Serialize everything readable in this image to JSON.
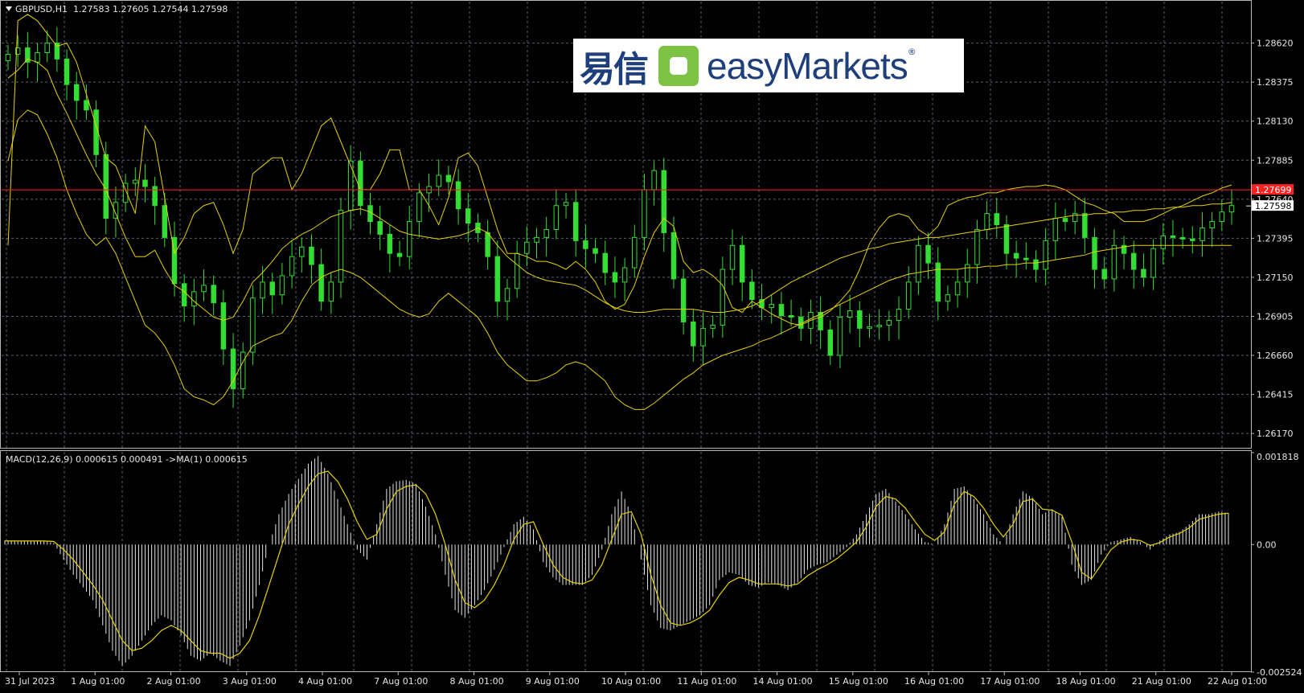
{
  "header": {
    "symbol": "GBPUSD,H1",
    "ohlc": "1.27583 1.27605 1.27544 1.27598"
  },
  "macd_header": "MACD(12,26,9) 0.000615 0.000491  ->MA(1) 0.000615",
  "logo": {
    "cn": "易信",
    "en": "easyMarkets",
    "reg": "®"
  },
  "colors": {
    "background": "#000000",
    "candle": "#33dd33",
    "bollinger": "#e6d200",
    "macd_hist": "#e6e6e6",
    "signal": "#e6d200",
    "ref_line": "#ff2020",
    "grid": "#566074",
    "axis_text": "#e6e6e6"
  },
  "price_labels": {
    "ref": "1.27699",
    "current": "1.27598"
  },
  "chart_data": [
    {
      "type": "line",
      "name": "price",
      "y_ticks": [
        "1.28620",
        "1.28375",
        "1.28130",
        "1.27885",
        "1.27640",
        "1.27395",
        "1.27150",
        "1.26905",
        "1.26660",
        "1.26415",
        "1.26170"
      ],
      "ylim": [
        1.2608,
        1.2885
      ],
      "x_tick_labels": [
        "31 Jul 2023",
        "1 Aug 01:00",
        "2 Aug 01:00",
        "3 Aug 01:00",
        "4 Aug 01:00",
        "7 Aug 01:00",
        "8 Aug 01:00",
        "9 Aug 01:00",
        "10 Aug 01:00",
        "11 Aug 01:00",
        "14 Aug 01:00",
        "15 Aug 01:00",
        "16 Aug 01:00",
        "17 Aug 01:00",
        "18 Aug 01:00",
        "21 Aug 01:00",
        "22 Aug 01:00"
      ],
      "close": [
        1.2855,
        1.2859,
        1.285,
        1.2856,
        1.2862,
        1.2852,
        1.2836,
        1.2826,
        1.282,
        1.2792,
        1.2752,
        1.2762,
        1.2774,
        1.2776,
        1.2772,
        1.276,
        1.274,
        1.2711,
        1.2697,
        1.2706,
        1.271,
        1.2699,
        1.267,
        1.2645,
        1.2668,
        1.2702,
        1.2712,
        1.2704,
        1.2716,
        1.2728,
        1.2734,
        1.2723,
        1.27,
        1.2712,
        1.2757,
        1.2788,
        1.276,
        1.275,
        1.2742,
        1.273,
        1.2728,
        1.275,
        1.2768,
        1.2772,
        1.2779,
        1.2775,
        1.2758,
        1.2749,
        1.2743,
        1.2728,
        1.27,
        1.2708,
        1.273,
        1.2737,
        1.274,
        1.2745,
        1.276,
        1.2762,
        1.2738,
        1.2733,
        1.273,
        1.2718,
        1.2712,
        1.2721,
        1.274,
        1.277,
        1.2782,
        1.2743,
        1.2714,
        1.2687,
        1.2672,
        1.2683,
        1.2685,
        1.272,
        1.2735,
        1.2712,
        1.2701,
        1.2696,
        1.2698,
        1.2691,
        1.269,
        1.2683,
        1.2693,
        1.2682,
        1.2666,
        1.269,
        1.2694,
        1.2683,
        1.2684,
        1.2685,
        1.2688,
        1.2695,
        1.2712,
        1.2735,
        1.2724,
        1.27,
        1.2704,
        1.2712,
        1.2723,
        1.2745,
        1.2755,
        1.2748,
        1.273,
        1.2727,
        1.2726,
        1.272,
        1.2738,
        1.2752,
        1.275,
        1.2755,
        1.274,
        1.272,
        1.2714,
        1.2735,
        1.273,
        1.272,
        1.2715,
        1.2733,
        1.2741,
        1.274,
        1.2739,
        1.2738,
        1.2746,
        1.275,
        1.2756,
        1.276
      ],
      "bollinger_upper": [
        1.2735,
        1.2876,
        1.288,
        1.2876,
        1.2868,
        1.286,
        1.2862,
        1.285,
        1.283,
        1.281,
        1.279,
        1.2785,
        1.277,
        1.2755,
        1.281,
        1.28,
        1.2765,
        1.273,
        1.274,
        1.2755,
        1.276,
        1.2762,
        1.2748,
        1.273,
        1.2745,
        1.278,
        1.2785,
        1.279,
        1.279,
        1.277,
        1.278,
        1.2795,
        1.281,
        1.2815,
        1.28,
        1.2785,
        1.277,
        1.277,
        1.278,
        1.2795,
        1.2795,
        1.277,
        1.277,
        1.276,
        1.2748,
        1.2765,
        1.279,
        1.2793,
        1.2785,
        1.2765,
        1.2745,
        1.273,
        1.273,
        1.2728,
        1.2725,
        1.2725,
        1.2723,
        1.272,
        1.2725,
        1.272,
        1.2712,
        1.27,
        1.2695,
        1.2698,
        1.271,
        1.2728,
        1.2743,
        1.2752,
        1.2747,
        1.2725,
        1.2718,
        1.272,
        1.2716,
        1.271,
        1.2696,
        1.2693,
        1.27,
        1.2696,
        1.2692,
        1.2689,
        1.2686,
        1.2685,
        1.2688,
        1.269,
        1.2694,
        1.27,
        1.2707,
        1.272,
        1.2736,
        1.2746,
        1.2753,
        1.2755,
        1.2753,
        1.2745,
        1.2741,
        1.2747,
        1.276,
        1.2763,
        1.2765,
        1.2766,
        1.2768,
        1.2768,
        1.277,
        1.2771,
        1.2772,
        1.2772,
        1.2773,
        1.2772,
        1.277,
        1.2766,
        1.2762,
        1.276,
        1.2757,
        1.2755,
        1.275,
        1.275,
        1.275,
        1.2752,
        1.2755,
        1.2758,
        1.276,
        1.2763,
        1.2766,
        1.2768,
        1.2771,
        1.2773
      ],
      "bollinger_middle": [
        1.284,
        1.2845,
        1.2852,
        1.285,
        1.2845,
        1.283,
        1.2818,
        1.2805,
        1.2792,
        1.278,
        1.277,
        1.2755,
        1.274,
        1.2728,
        1.2728,
        1.2732,
        1.272,
        1.271,
        1.2706,
        1.27,
        1.2695,
        1.269,
        1.2688,
        1.269,
        1.27,
        1.2712,
        1.2718,
        1.2725,
        1.2733,
        1.2738,
        1.2742,
        1.2745,
        1.2749,
        1.2753,
        1.2755,
        1.2757,
        1.2758,
        1.2756,
        1.2752,
        1.2748,
        1.2744,
        1.2742,
        1.2741,
        1.274,
        1.2739,
        1.274,
        1.2741,
        1.2743,
        1.2746,
        1.2743,
        1.2735,
        1.2728,
        1.2723,
        1.2718,
        1.2715,
        1.2713,
        1.2712,
        1.2711,
        1.271,
        1.2707,
        1.2703,
        1.2699,
        1.2696,
        1.2694,
        1.2693,
        1.2693,
        1.2694,
        1.2695,
        1.2695,
        1.2695,
        1.2695,
        1.2694,
        1.2693,
        1.2693,
        1.2694,
        1.2695,
        1.2697,
        1.27,
        1.2704,
        1.2708,
        1.2712,
        1.2715,
        1.2718,
        1.2721,
        1.2724,
        1.2727,
        1.2729,
        1.2731,
        1.2733,
        1.2734,
        1.2736,
        1.2737,
        1.2738,
        1.2739,
        1.274,
        1.274,
        1.2741,
        1.2742,
        1.2743,
        1.2744,
        1.2745,
        1.2746,
        1.2747,
        1.2748,
        1.2749,
        1.275,
        1.2751,
        1.2752,
        1.2753,
        1.2754,
        1.2754,
        1.2755,
        1.2755,
        1.2756,
        1.2756,
        1.2757,
        1.2757,
        1.2758,
        1.2758,
        1.2759,
        1.2759,
        1.276,
        1.276,
        1.2761,
        1.2761,
        1.2762
      ],
      "bollinger_lower": [
        1.2788,
        1.2814,
        1.282,
        1.2817,
        1.2805,
        1.279,
        1.277,
        1.2755,
        1.2742,
        1.2735,
        1.274,
        1.273,
        1.2715,
        1.27,
        1.2685,
        1.268,
        1.2672,
        1.266,
        1.2645,
        1.264,
        1.2638,
        1.2635,
        1.264,
        1.265,
        1.2662,
        1.2672,
        1.2675,
        1.2678,
        1.268,
        1.2688,
        1.27,
        1.271,
        1.2715,
        1.2718,
        1.272,
        1.2718,
        1.2715,
        1.271,
        1.2705,
        1.27,
        1.2695,
        1.2692,
        1.269,
        1.2692,
        1.27,
        1.2705,
        1.27,
        1.2695,
        1.269,
        1.268,
        1.2668,
        1.266,
        1.2655,
        1.265,
        1.265,
        1.2652,
        1.2655,
        1.266,
        1.2662,
        1.266,
        1.2655,
        1.265,
        1.264,
        1.2635,
        1.2632,
        1.2632,
        1.2636,
        1.2641,
        1.2646,
        1.2651,
        1.2655,
        1.266,
        1.2663,
        1.2666,
        1.2668,
        1.267,
        1.2672,
        1.2675,
        1.2677,
        1.268,
        1.2683,
        1.2686,
        1.2689,
        1.2692,
        1.2695,
        1.2698,
        1.2701,
        1.2704,
        1.2707,
        1.271,
        1.2713,
        1.2715,
        1.2717,
        1.2718,
        1.2719,
        1.272,
        1.272,
        1.272,
        1.2721,
        1.2721,
        1.2722,
        1.2722,
        1.2723,
        1.2723,
        1.2724,
        1.2724,
        1.2725,
        1.2726,
        1.2727,
        1.2728,
        1.2729,
        1.2731,
        1.2732,
        1.2733,
        1.2734,
        1.2735,
        1.2735,
        1.2735,
        1.2735,
        1.2735,
        1.2735,
        1.2735,
        1.2735,
        1.2735,
        1.2735,
        1.2735
      ],
      "reference_level": 1.27699,
      "current_price": 1.27598
    },
    {
      "type": "bar",
      "name": "MACD(12,26,9)",
      "y_ticks": [
        "0.001818",
        "0.00",
        "-0.002524"
      ],
      "ylim": [
        -0.002524,
        0.001818
      ],
      "histogram": [
        8e-05,
        8e-05,
        7e-05,
        7e-05,
        7e-05,
        3e-05,
        -0.0003,
        -0.0006,
        -0.00085,
        -0.0011,
        -0.0016,
        -0.0021,
        -0.0024,
        -0.0022,
        -0.0019,
        -0.0016,
        -0.0014,
        -0.0015,
        -0.0018,
        -0.0022,
        -0.0023,
        -0.00215,
        -0.0023,
        -0.0024,
        -0.002,
        -0.0015,
        -0.0008,
        0.0,
        0.0006,
        0.001,
        0.0013,
        0.0016,
        0.00175,
        0.0014,
        0.0009,
        0.0004,
        -0.0001,
        -0.0003,
        0.0004,
        0.0011,
        0.00125,
        0.00128,
        0.0012,
        0.00075,
        0.0002,
        -0.0006,
        -0.0013,
        -0.00145,
        -0.0012,
        -0.0009,
        -0.0005,
        -5e-05,
        0.0004,
        0.00055,
        0.0003,
        -0.00035,
        -0.00065,
        -0.0008,
        -0.0008,
        -0.0008,
        -0.0006,
        -0.0001,
        0.0006,
        0.00105,
        0.0006,
        -0.0003,
        -0.0012,
        -0.00165,
        -0.0017,
        -0.0016,
        -0.0015,
        -0.0014,
        -0.0012,
        -0.0007,
        -0.00055,
        -0.0006,
        -0.0008,
        -0.00085,
        -0.00075,
        -0.0008,
        -0.0009,
        -0.00075,
        -0.0005,
        -0.0004,
        -0.00035,
        -0.0002,
        -5e-05,
        0.0002,
        0.0006,
        0.001,
        0.0011,
        0.00085,
        0.0006,
        0.0003,
        5e-05,
        0.0,
        0.0004,
        0.0011,
        0.00115,
        0.0009,
        0.0006,
        0.0002,
        0.0,
        0.0006,
        0.00105,
        0.00092,
        0.0006,
        0.0007,
        0.00055,
        -0.0004,
        -0.0008,
        -0.0007,
        -0.0002,
        5e-05,
        0.0001,
        0.00015,
        5e-05,
        -0.0001,
        8e-05,
        0.0002,
        0.00025,
        0.0004,
        0.0006,
        0.0006,
        0.00065,
        0.00062
      ],
      "signal": [
        7e-05,
        7e-05,
        7e-05,
        7e-05,
        7e-05,
        6e-05,
        -0.0001,
        -0.0003,
        -0.00055,
        -0.0008,
        -0.0011,
        -0.0015,
        -0.0019,
        -0.0021,
        -0.00205,
        -0.0019,
        -0.0017,
        -0.0016,
        -0.0017,
        -0.0019,
        -0.0021,
        -0.00215,
        -0.00215,
        -0.00225,
        -0.00215,
        -0.0019,
        -0.0014,
        -0.0008,
        -0.0002,
        0.0004,
        0.0008,
        0.00115,
        0.0014,
        0.00145,
        0.00125,
        0.0009,
        0.00045,
        0.0001,
        0.0002,
        0.0007,
        0.00105,
        0.00115,
        0.00118,
        0.001,
        0.0006,
        0.0,
        -0.0007,
        -0.00115,
        -0.00125,
        -0.0011,
        -0.0008,
        -0.0004,
        0.0001,
        0.0004,
        0.00045,
        0.0,
        -0.0004,
        -0.00065,
        -0.00075,
        -0.00078,
        -0.0007,
        -0.0004,
        0.0001,
        0.0006,
        0.00065,
        0.0002,
        -0.0006,
        -0.0012,
        -0.00155,
        -0.0016,
        -0.00155,
        -0.00145,
        -0.0013,
        -0.001,
        -0.00075,
        -0.00065,
        -0.0007,
        -0.00078,
        -0.00078,
        -0.00078,
        -0.00082,
        -0.00078,
        -0.00062,
        -0.0005,
        -0.0004,
        -0.00028,
        -0.00012,
        5e-05,
        0.00035,
        0.00075,
        0.00095,
        0.0009,
        0.00072,
        0.00045,
        0.0002,
        8e-05,
        0.00025,
        0.0008,
        0.00105,
        0.00095,
        0.00072,
        0.0004,
        0.00015,
        0.0004,
        0.00085,
        0.0009,
        0.0007,
        0.00068,
        0.00058,
        5e-05,
        -0.00055,
        -0.00068,
        -0.0004,
        -0.0001,
        5e-05,
        0.0001,
        8e-05,
        -2e-05,
        4e-05,
        0.00015,
        0.00022,
        0.00033,
        0.0005,
        0.00055,
        0.0006,
        0.00062
      ]
    }
  ]
}
